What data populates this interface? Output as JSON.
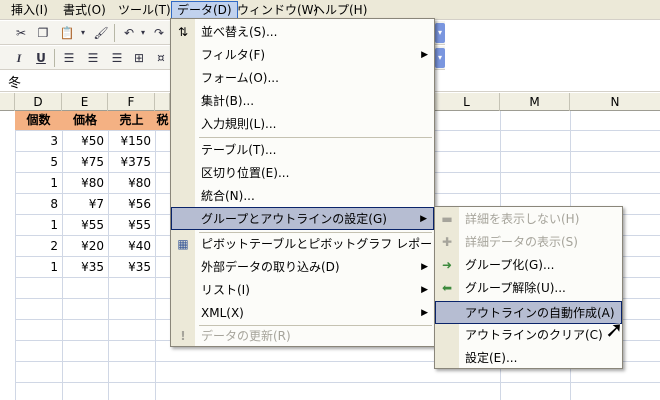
{
  "menubar": {
    "items": [
      {
        "label": "挿入(I)",
        "active": false
      },
      {
        "label": "書式(O)",
        "active": false
      },
      {
        "label": "ツール(T)",
        "active": false
      },
      {
        "label": "データ(D)",
        "active": true
      },
      {
        "label": "ウィンドウ(W)",
        "active": false
      },
      {
        "label": "ヘルプ(H)",
        "active": false
      }
    ]
  },
  "formula_bar": {
    "value": "冬"
  },
  "columns": [
    "D",
    "E",
    "F",
    "",
    "L",
    "M",
    "N"
  ],
  "sheet": {
    "header_row": [
      "個数",
      "価格",
      "売上",
      "税"
    ],
    "rows": [
      [
        "3",
        "¥50",
        "¥150"
      ],
      [
        "5",
        "¥75",
        "¥375"
      ],
      [
        "1",
        "¥80",
        "¥80"
      ],
      [
        "8",
        "¥7",
        "¥56"
      ],
      [
        "1",
        "¥55",
        "¥55"
      ],
      [
        "2",
        "¥20",
        "¥40"
      ],
      [
        "1",
        "¥35",
        "¥35"
      ]
    ],
    "header_color": "#f4b183"
  },
  "data_menu": {
    "items": [
      {
        "label": "並べ替え(S)...",
        "icon": "sort-icon",
        "glyph": "⇅"
      },
      {
        "label": "フィルタ(F)",
        "submenu": true
      },
      {
        "label": "フォーム(O)..."
      },
      {
        "label": "集計(B)..."
      },
      {
        "label": "入力規則(L)..."
      },
      {
        "label": "テーブル(T)..."
      },
      {
        "label": "区切り位置(E)..."
      },
      {
        "label": "統合(N)..."
      },
      {
        "label": "グループとアウトラインの設定(G)",
        "submenu": true,
        "highlighted": true
      },
      {
        "label": "ピボットテーブルとピボットグラフ レポート(P)...",
        "icon": "pivot-table-icon",
        "glyph": "▦"
      },
      {
        "label": "外部データの取り込み(D)",
        "submenu": true
      },
      {
        "label": "リスト(I)",
        "submenu": true
      },
      {
        "label": "XML(X)",
        "submenu": true
      },
      {
        "label": "データの更新(R)",
        "disabled": true,
        "icon": "refresh-icon",
        "glyph": "!"
      }
    ]
  },
  "outline_submenu": {
    "items": [
      {
        "label": "詳細を表示しない(H)",
        "disabled": true,
        "icon": "hide-detail-icon",
        "glyph": "▬"
      },
      {
        "label": "詳細データの表示(S)",
        "disabled": true,
        "icon": "show-detail-icon",
        "glyph": "✚"
      },
      {
        "label": "グループ化(G)...",
        "icon": "group-icon",
        "glyph": "➜"
      },
      {
        "label": "グループ解除(U)...",
        "icon": "ungroup-icon",
        "glyph": "⬅"
      },
      {
        "label": "アウトラインの自動作成(A)",
        "highlighted": true
      },
      {
        "label": "アウトラインのクリア(C)"
      },
      {
        "label": "設定(E)..."
      }
    ]
  }
}
